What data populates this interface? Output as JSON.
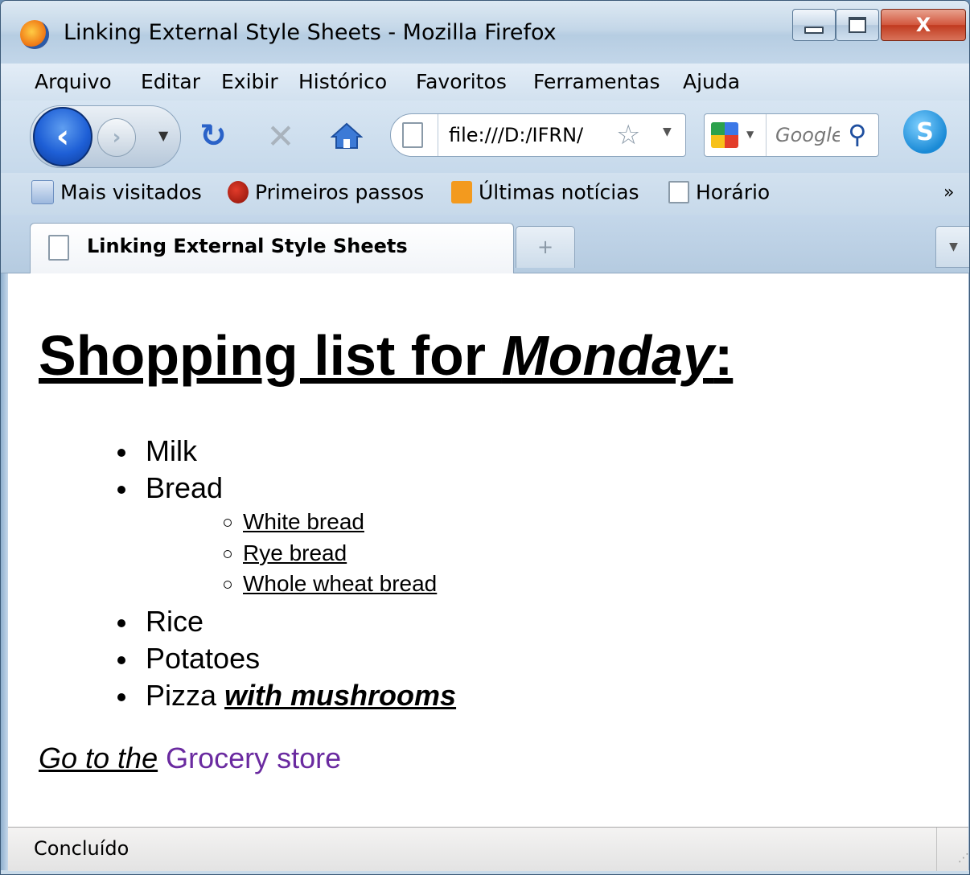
{
  "window": {
    "title": "Linking External Style Sheets - Mozilla Firefox",
    "close_glyph": "X"
  },
  "menu": {
    "items": [
      "Arquivo",
      "Editar",
      "Exibir",
      "Histórico",
      "Favoritos",
      "Ferramentas",
      "Ajuda"
    ]
  },
  "nav": {
    "back_glyph": "‹",
    "forward_glyph": "›",
    "url": "file:///D:/IFRN/",
    "search_placeholder": "Google"
  },
  "bookmarks": {
    "items": [
      "Mais visitados",
      "Primeiros passos",
      "Últimas notícias",
      "Horário"
    ],
    "more_glyph": "»"
  },
  "tabs": {
    "active_label": "Linking External Style Sheets",
    "new_tab_glyph": "+"
  },
  "page": {
    "heading_prefix": "Shopping list for ",
    "heading_emph": "Monday",
    "heading_suffix": ":",
    "items": {
      "milk": "Milk",
      "bread": "Bread",
      "rice": "Rice",
      "potatoes": "Potatoes",
      "pizza": "Pizza"
    },
    "pizza_emph": "with mushrooms",
    "bread_types": [
      "White bread",
      "Rye bread",
      "Whole wheat bread"
    ],
    "goto_prefix": "Go to the",
    "goto_link": "Grocery store"
  },
  "status": {
    "text": "Concluído"
  },
  "colors": {
    "link_visited": "#6a2aa0",
    "close_button": "#c03a1f",
    "back_button": "#1e5fd6"
  }
}
